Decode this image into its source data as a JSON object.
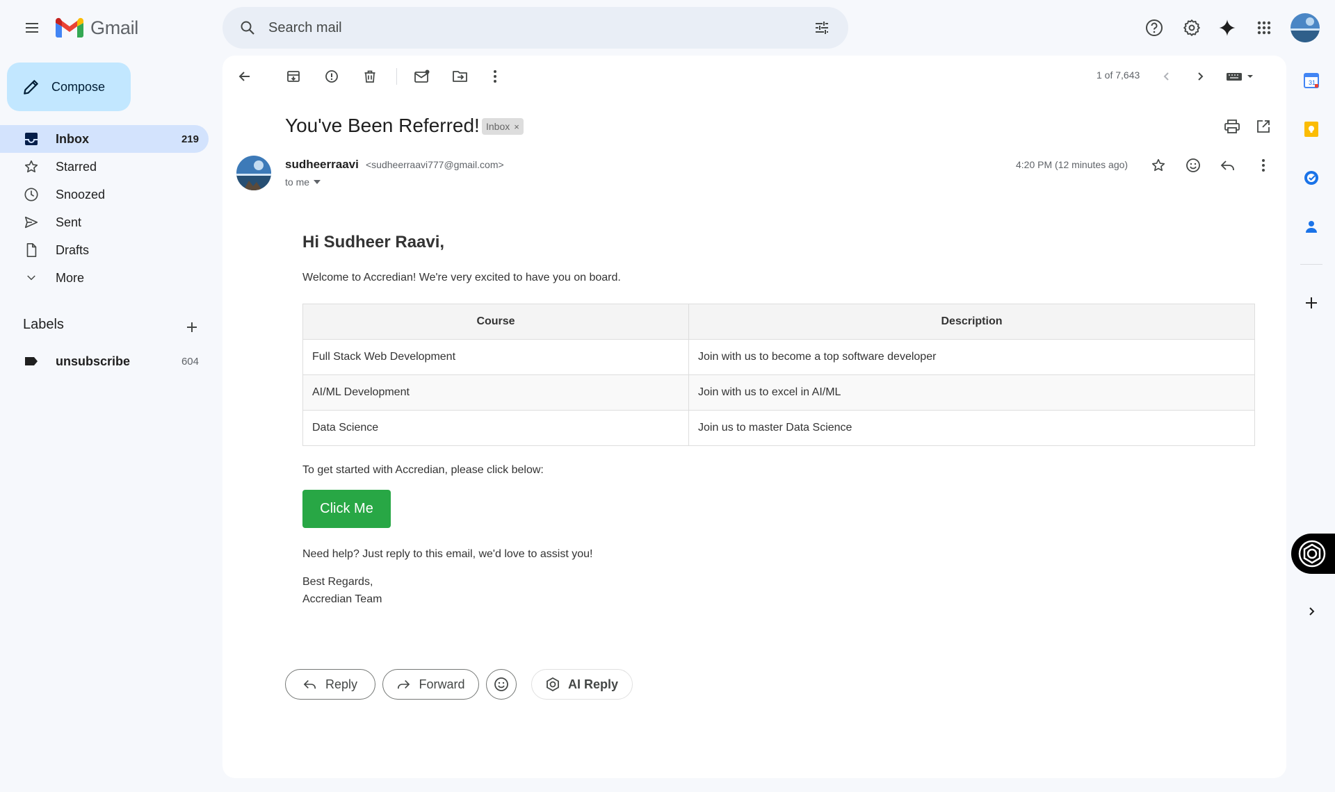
{
  "app": {
    "name": "Gmail",
    "search_placeholder": "Search mail"
  },
  "sidebar": {
    "compose_label": "Compose",
    "items": [
      {
        "label": "Inbox",
        "count": "219",
        "icon": "inbox-icon"
      },
      {
        "label": "Starred",
        "count": "",
        "icon": "star-icon"
      },
      {
        "label": "Snoozed",
        "count": "",
        "icon": "clock-icon"
      },
      {
        "label": "Sent",
        "count": "",
        "icon": "send-icon"
      },
      {
        "label": "Drafts",
        "count": "",
        "icon": "draft-icon"
      },
      {
        "label": "More",
        "count": "",
        "icon": "chevron-down-icon"
      }
    ],
    "labels_heading": "Labels",
    "labels": [
      {
        "label": "unsubscribe",
        "count": "604"
      }
    ]
  },
  "toolbar": {
    "page_count": "1 of 7,643"
  },
  "message": {
    "subject": "You've Been Referred!",
    "chip": "Inbox",
    "chip_close": "×",
    "sender_name": "sudheerraavi",
    "sender_email": "<sudheerraavi777@gmail.com>",
    "to": "to me",
    "time": "4:20 PM (12 minutes ago)"
  },
  "email": {
    "greeting": "Hi Sudheer Raavi,",
    "intro": "Welcome to Accredian! We're very excited to have you on board.",
    "table_headers": [
      "Course",
      "Description"
    ],
    "table_rows": [
      [
        "Full Stack Web Development",
        "Join with us to become a top software developer"
      ],
      [
        "AI/ML Development",
        "Join with us to excel in AI/ML"
      ],
      [
        "Data Science",
        "Join us to master Data Science"
      ]
    ],
    "get_started": "To get started with Accredian, please click below:",
    "cta": "Click Me",
    "help": "Need help? Just reply to this email, we'd love to assist you!",
    "signoff": "Best Regards,",
    "team": "Accredian Team"
  },
  "actions": {
    "reply": "Reply",
    "forward": "Forward",
    "ai_reply": "AI Reply"
  },
  "colors": {
    "compose_bg": "#c2e7ff",
    "active_nav_bg": "#d3e3fd",
    "cta_green": "#28a745",
    "search_bg": "#e9eef6"
  }
}
